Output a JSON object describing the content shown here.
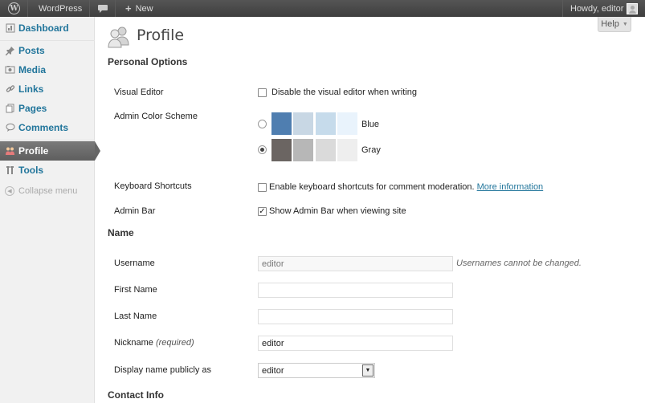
{
  "adminbar": {
    "site_name": "WordPress",
    "new_label": "New",
    "greeting": "Howdy, editor"
  },
  "help": {
    "label": "Help"
  },
  "sidebar": {
    "items": [
      {
        "label": "Dashboard",
        "icon": "dashboard-icon"
      },
      {
        "label": "Posts",
        "icon": "pushpin-icon"
      },
      {
        "label": "Media",
        "icon": "media-icon"
      },
      {
        "label": "Links",
        "icon": "link-icon"
      },
      {
        "label": "Pages",
        "icon": "pages-icon"
      },
      {
        "label": "Comments",
        "icon": "comment-icon"
      },
      {
        "label": "Profile",
        "icon": "users-icon",
        "current": true
      },
      {
        "label": "Tools",
        "icon": "tools-icon"
      }
    ],
    "collapse_label": "Collapse menu"
  },
  "page": {
    "title": "Profile"
  },
  "personal_options": {
    "heading": "Personal Options",
    "visual_editor": {
      "label": "Visual Editor",
      "checkbox_text": "Disable the visual editor when writing",
      "checked": false
    },
    "color_scheme": {
      "label": "Admin Color Scheme",
      "options": [
        {
          "name": "Blue",
          "selected": false,
          "colors": [
            "#4f7eb0",
            "#c8d7e4",
            "#c6dbeb",
            "#e9f3fc"
          ]
        },
        {
          "name": "Gray",
          "selected": true,
          "colors": [
            "#6b6562",
            "#b7b7b7",
            "#dadada",
            "#eeeeee"
          ]
        }
      ]
    },
    "keyboard_shortcuts": {
      "label": "Keyboard Shortcuts",
      "checkbox_text": "Enable keyboard shortcuts for comment moderation.",
      "link_text": "More information",
      "checked": false
    },
    "admin_bar": {
      "label": "Admin Bar",
      "checkbox_text": "Show Admin Bar when viewing site",
      "checked": true
    }
  },
  "name_section": {
    "heading": "Name",
    "username": {
      "label": "Username",
      "value": "editor",
      "note": "Usernames cannot be changed."
    },
    "first_name": {
      "label": "First Name",
      "value": ""
    },
    "last_name": {
      "label": "Last Name",
      "value": ""
    },
    "nickname": {
      "label": "Nickname",
      "required": "(required)",
      "value": "editor"
    },
    "display_name": {
      "label": "Display name publicly as",
      "value": "editor"
    }
  },
  "contact_info": {
    "heading": "Contact Info"
  }
}
